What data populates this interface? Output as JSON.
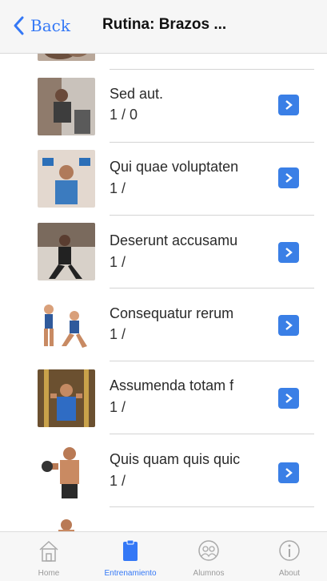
{
  "navbar": {
    "back_label": "Back",
    "title": "Rutina: Brazos ..."
  },
  "exercises": [
    {
      "title": "",
      "subtitle": "",
      "thumb": "arms-workout-photo"
    },
    {
      "title": "Sed aut.",
      "subtitle": "1 / 0",
      "thumb": "gym-sitting-photo"
    },
    {
      "title": "Qui quae voluptaten",
      "subtitle": "1 /",
      "thumb": "dumbbell-press-photo"
    },
    {
      "title": "Deserunt accusamu",
      "subtitle": "1 /",
      "thumb": "lunge-photo"
    },
    {
      "title": "Consequatur rerum",
      "subtitle": "1 /",
      "thumb": "lunge-illustration"
    },
    {
      "title": "Assumenda totam f",
      "subtitle": "1 /",
      "thumb": "cable-machine-photo"
    },
    {
      "title": "Quis quam quis quic",
      "subtitle": "1 /",
      "thumb": "dumbbell-curl-photo"
    },
    {
      "title": "",
      "subtitle": "",
      "thumb": "partial-exercise-photo"
    }
  ],
  "tabbar": {
    "tabs": [
      {
        "label": "Home",
        "icon": "home-icon",
        "active": false
      },
      {
        "label": "Entrenamiento",
        "icon": "clipboard-icon",
        "active": true
      },
      {
        "label": "Alumnos",
        "icon": "group-icon",
        "active": false
      },
      {
        "label": "About",
        "icon": "info-icon",
        "active": false
      }
    ]
  },
  "colors": {
    "accent": "#3478f6",
    "detail_button": "#3a7fe6"
  }
}
